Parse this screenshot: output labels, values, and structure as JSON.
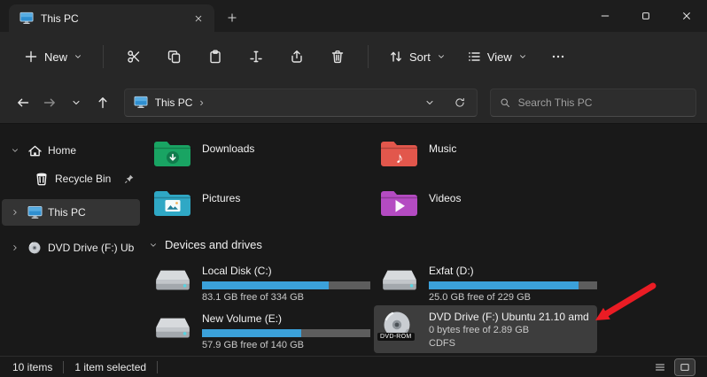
{
  "window": {
    "tab_title": "This PC"
  },
  "toolbar": {
    "new_label": "New",
    "sort_label": "Sort",
    "view_label": "View"
  },
  "navbar": {
    "breadcrumb": "This PC",
    "breadcrumb_chevron": "›",
    "search_placeholder": "Search This PC"
  },
  "sidebar": {
    "items": [
      {
        "label": "Home"
      },
      {
        "label": "Recycle Bin"
      },
      {
        "label": "This PC"
      },
      {
        "label": "DVD Drive (F:) Ubun"
      }
    ]
  },
  "content": {
    "folders": [
      {
        "name": "Downloads"
      },
      {
        "name": "Music"
      },
      {
        "name": "Pictures"
      },
      {
        "name": "Videos"
      }
    ],
    "section_header": "Devices and drives",
    "drives": [
      {
        "name": "Local Disk (C:)",
        "free_text": "83.1 GB free of 334 GB",
        "used_pct": 75
      },
      {
        "name": "Exfat (D:)",
        "free_text": "25.0 GB free of 229 GB",
        "used_pct": 89
      },
      {
        "name": "New Volume (E:)",
        "free_text": "57.9 GB free of 140 GB",
        "used_pct": 59
      },
      {
        "name": "DVD Drive (F:) Ubuntu 21.10 amd",
        "free_text": "0 bytes free of 2.89 GB",
        "filesystem": "CDFS"
      }
    ],
    "dvd_badge": "DVD-ROM"
  },
  "statusbar": {
    "item_count": "10 items",
    "selection": "1 item selected"
  },
  "icons": {
    "music_note": "♪"
  },
  "colors": {
    "progress_fill": "#3ba1da",
    "selection_bg": "#3d3d3d",
    "annotation_red": "#ea1c24"
  }
}
